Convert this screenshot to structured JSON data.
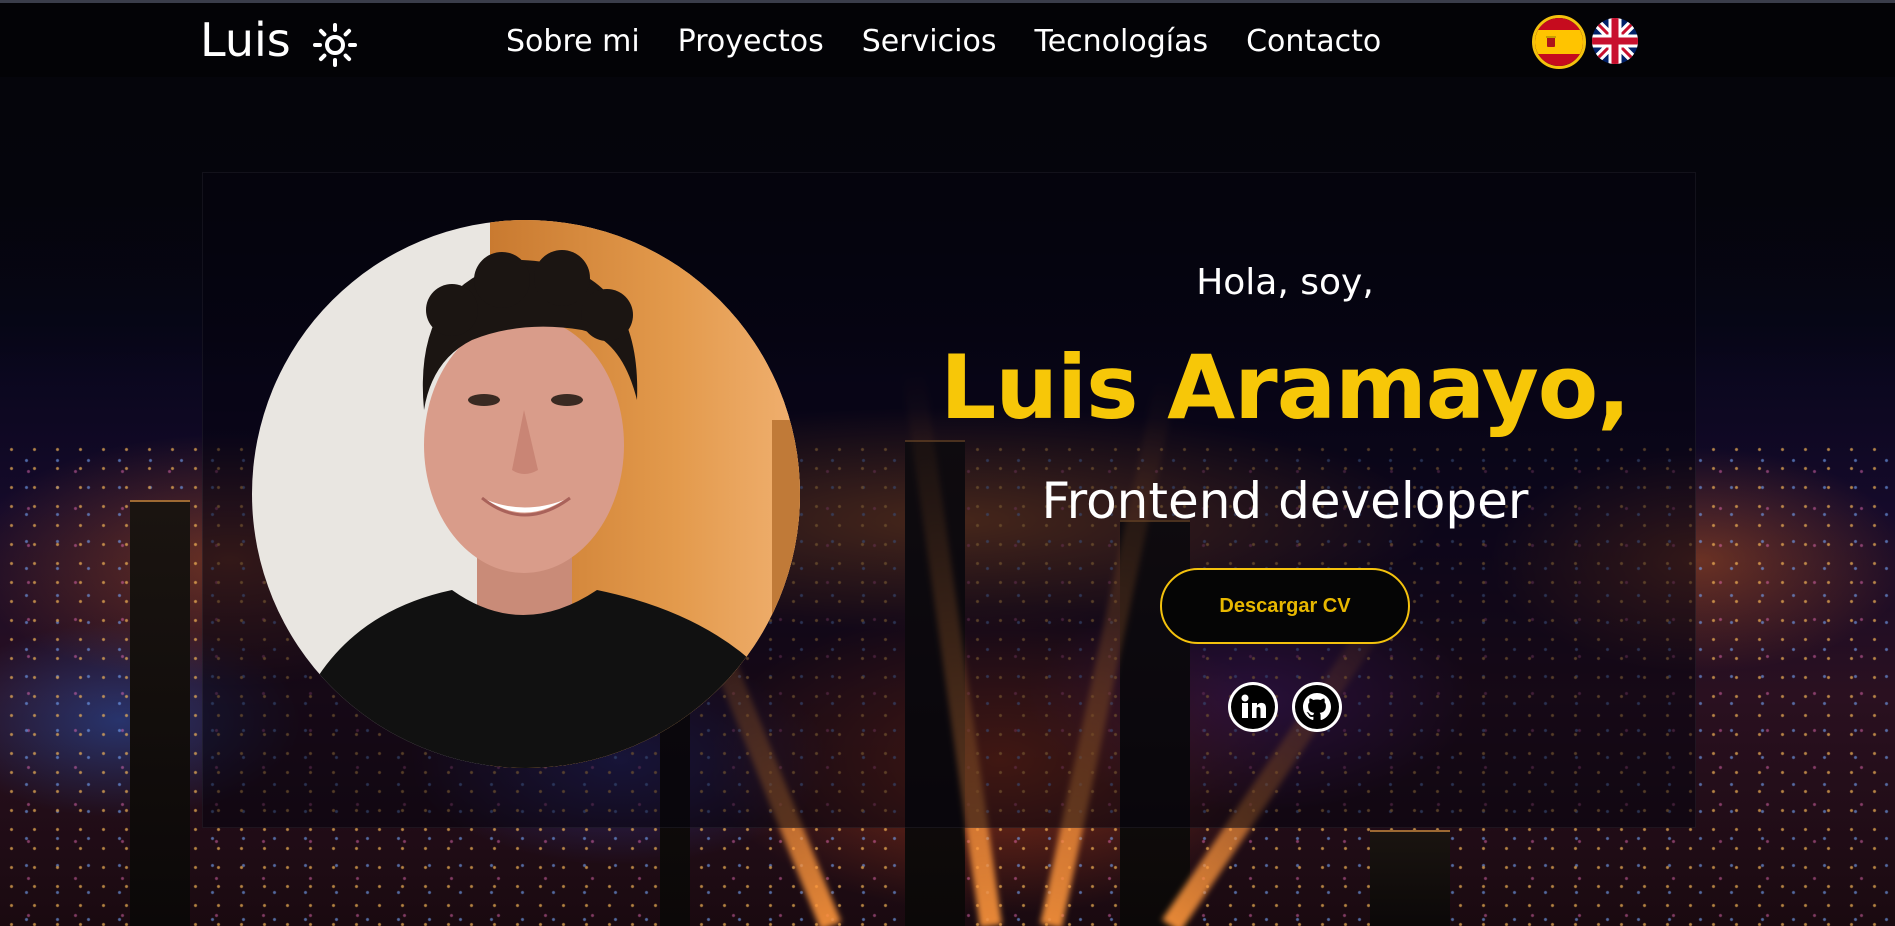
{
  "nav": {
    "logo": "Luis",
    "theme_icon": "sun-icon",
    "links": [
      {
        "label": "Sobre mi"
      },
      {
        "label": "Proyectos"
      },
      {
        "label": "Servicios"
      },
      {
        "label": "Tecnologías"
      },
      {
        "label": "Contacto"
      }
    ],
    "languages": [
      {
        "icon": "spain-flag-icon",
        "selected": true
      },
      {
        "icon": "uk-flag-icon",
        "selected": false
      }
    ]
  },
  "hero": {
    "greeting": "Hola, soy,",
    "name": "Luis Aramayo,",
    "role": "Frontend developer",
    "cv_button": "Descargar CV",
    "socials": [
      {
        "icon": "linkedin-icon"
      },
      {
        "icon": "github-icon"
      }
    ]
  },
  "colors": {
    "accent": "#f7c708",
    "nav_bg": "#030306",
    "text": "#ffffff"
  }
}
